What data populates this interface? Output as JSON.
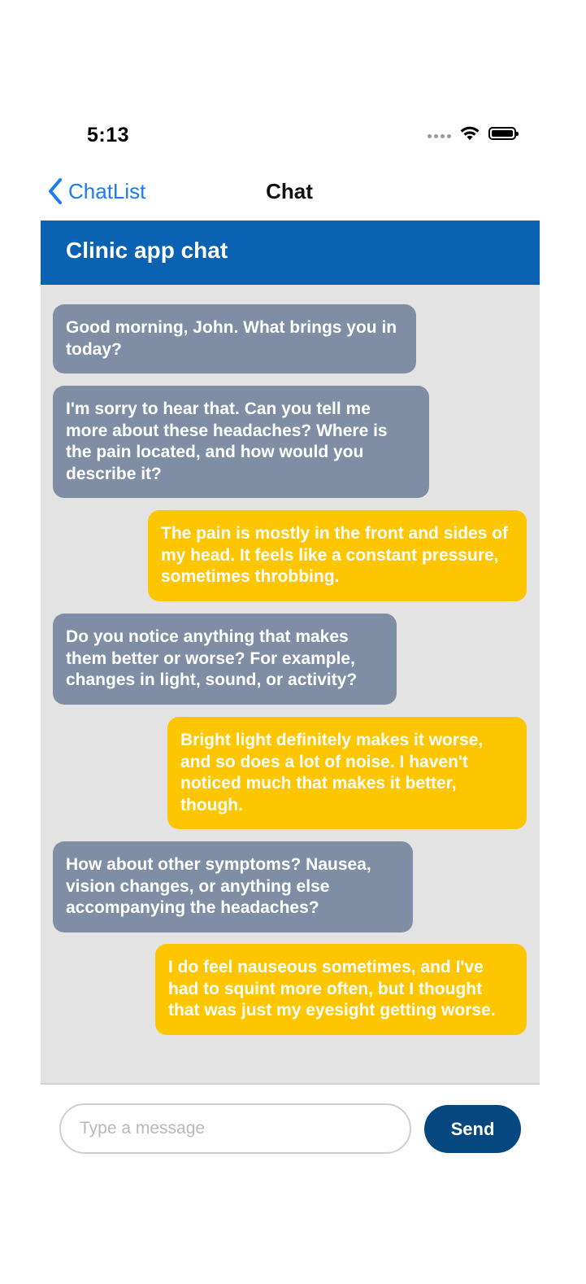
{
  "status_bar": {
    "time": "5:13",
    "icons": [
      "signal-dots-icon",
      "wifi-icon",
      "battery-icon"
    ]
  },
  "nav": {
    "back_label": "ChatList",
    "title": "Chat",
    "accent_color": "#1a7cf4"
  },
  "header": {
    "title": "Clinic app chat",
    "background_color": "#0b62b3"
  },
  "messages": [
    {
      "sender": "clinic",
      "text": "Good morning, John. What brings you in today?"
    },
    {
      "sender": "clinic",
      "text": "I'm sorry to hear that. Can you tell me more about these headaches? Where is the pain located, and how would you describe it?"
    },
    {
      "sender": "user",
      "text": "The pain is mostly in the front and sides of my head. It feels like a constant pressure, sometimes throbbing."
    },
    {
      "sender": "clinic",
      "text": "Do you notice anything that makes them better or worse? For example, changes in light, sound, or activity?"
    },
    {
      "sender": "user",
      "text": "Bright light definitely makes it worse, and so does a lot of noise. I haven't noticed much that makes it better, though."
    },
    {
      "sender": "clinic",
      "text": "How about other symptoms? Nausea, vision changes, or anything else accompanying the headaches?"
    },
    {
      "sender": "user",
      "text": "I do feel nauseous sometimes, and I've had to squint more often, but I thought that was just my eyesight getting worse."
    }
  ],
  "colors": {
    "incoming_bubble": "#7f8ea5",
    "outgoing_bubble": "#fdc600",
    "chat_background": "#e3e3e3",
    "send_button": "#05477f"
  },
  "composer": {
    "value": "",
    "placeholder": "Type a message",
    "send_label": "Send"
  }
}
